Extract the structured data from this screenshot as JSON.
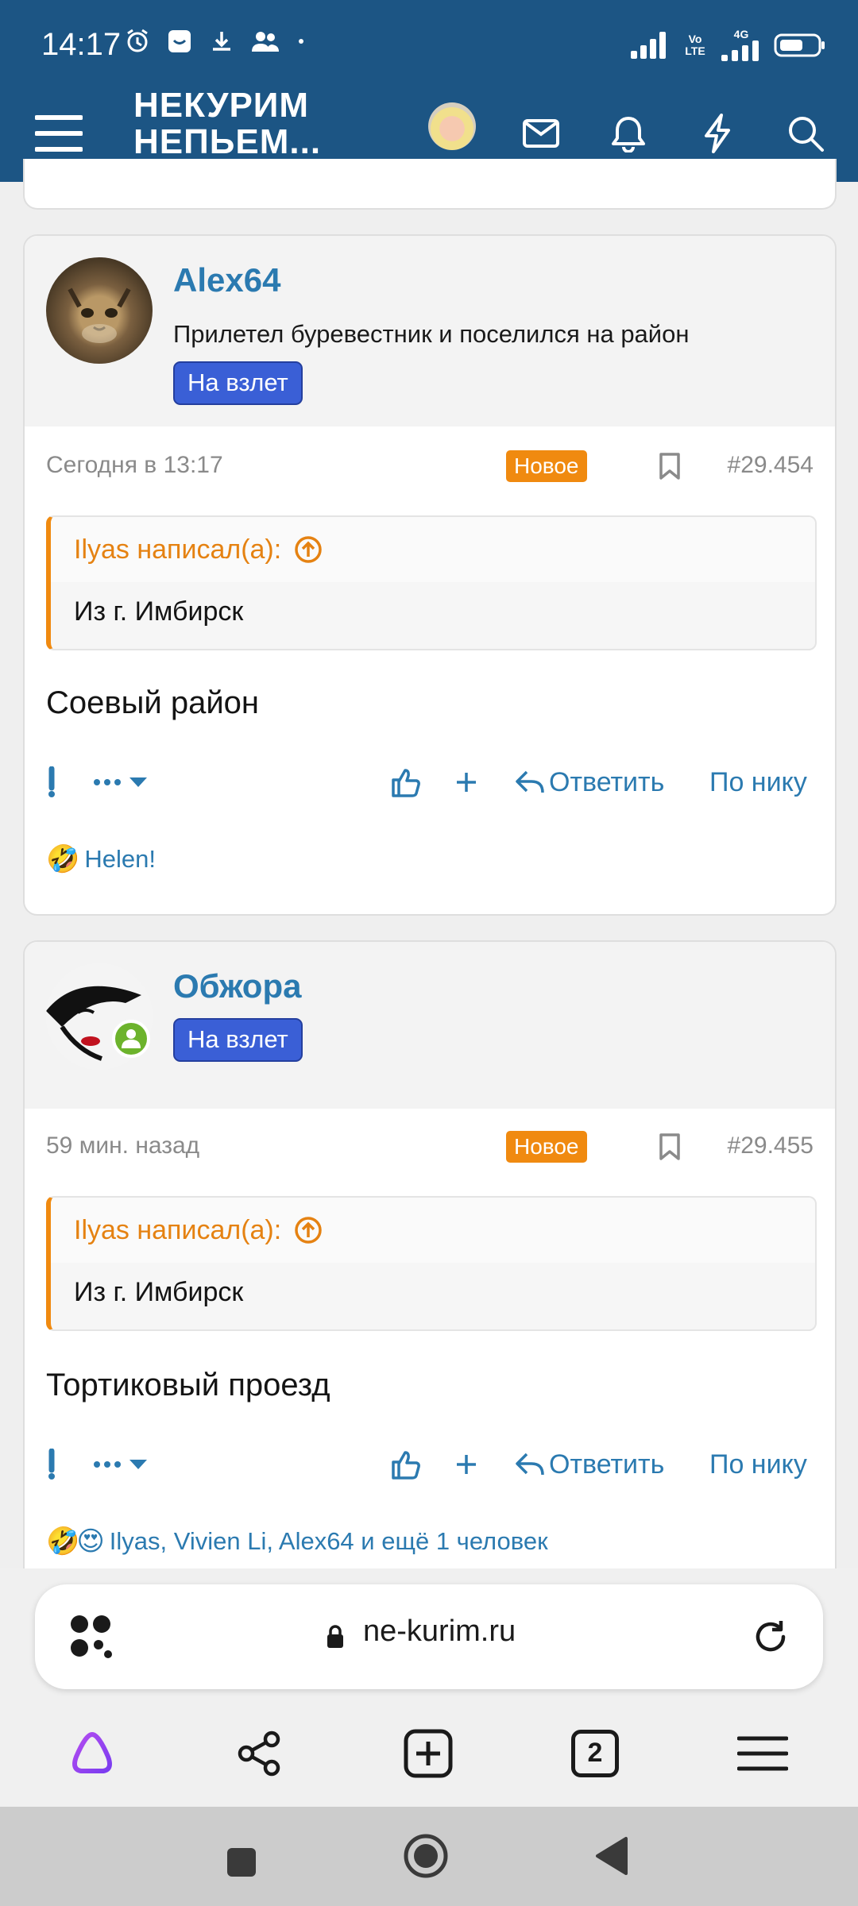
{
  "status_bar": {
    "time": "14:17",
    "network_label_1": "Vo LTE",
    "network_label_2": "4G"
  },
  "header": {
    "logo_line1": "НЕКУРИМ",
    "logo_line2": "НЕПЬЕМ..."
  },
  "posts": [
    {
      "username": "Alex64",
      "user_title": "Прилетел буревестник и поселился на район",
      "badge": "На взлет",
      "time": "Сегодня в 13:17",
      "new_tag": "Новое",
      "post_number": "#29.454",
      "quote_author": "Ilyas написал(а):",
      "quote_text": "Из г. Имбирск",
      "text": "Соевый район",
      "reply_label": "Ответить",
      "nick_label": "По нику",
      "reactions_text": "Helen!"
    },
    {
      "username": "Обжора",
      "badge": "На взлет",
      "time": "59 мин. назад",
      "new_tag": "Новое",
      "post_number": "#29.455",
      "quote_author": "Ilyas написал(а):",
      "quote_text": "Из г. Имбирск",
      "text": "Тортиковый проезд",
      "reply_label": "Ответить",
      "nick_label": "По нику",
      "reactions_text": "Ilyas, Vivien Li, Alex64 и ещё 1 человек"
    }
  ],
  "browser": {
    "url": "ne-kurim.ru",
    "tabs_count": "2"
  },
  "colors": {
    "header_bg": "#1c5584",
    "link_blue": "#2b7ab0",
    "badge_blue": "#3a5fd6",
    "new_orange": "#f08a10",
    "online_green": "#6cb32c"
  }
}
